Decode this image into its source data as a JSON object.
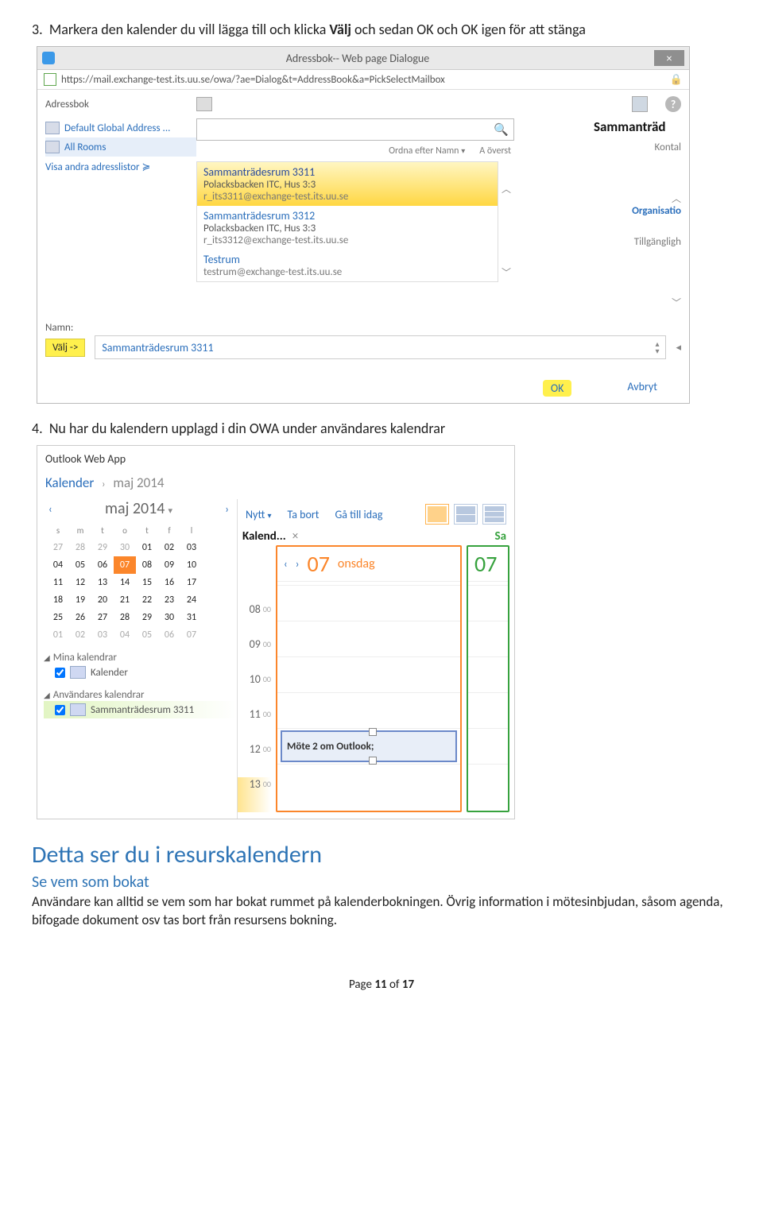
{
  "step3": {
    "num": "3.",
    "pre": "Markera den kalender du vill lägga till och klicka ",
    "b1": "Välj",
    "post": " och sedan OK och OK igen för att stänga"
  },
  "dlg": {
    "title": "Adressbok-- Web page Dialogue",
    "close": "×",
    "url": "https://mail.exchange-test.its.uu.se/owa/?ae=Dialog&t=AddressBook&a=PickSelectMailbox",
    "lock": "🔒",
    "addr_label": "Adressbok",
    "help": "?",
    "left": {
      "default": "Default Global Address ...",
      "all_rooms": "All Rooms",
      "show": "Visa andra adresslistor",
      "expand": "≽"
    },
    "search_mag": "🔍",
    "sort": {
      "ordna": "Ordna efter Namn",
      "arr": "▾",
      "overst": "A överst"
    },
    "list": [
      {
        "t1": "Sammanträdesrum 3311",
        "t2": "Polacksbacken ITC, Hus 3:3",
        "t3": "r_its3311@exchange-test.its.uu.se",
        "sel": true
      },
      {
        "t1": "Sammanträdesrum 3312",
        "t2": "Polacksbacken ITC, Hus 3:3",
        "t3": "r_its3312@exchange-test.its.uu.se",
        "sel": false
      },
      {
        "t1": "Testrum",
        "t2": "",
        "t3": "testrum@exchange-test.its.uu.se",
        "sel": false
      }
    ],
    "scroll": {
      "up": "︿",
      "down": "﹀"
    },
    "right": {
      "hdr": "Sammanträd",
      "kontal": "Kontal",
      "up": "︿",
      "org": "Organisatio",
      "avail": "Tillgängligh",
      "down": "﹀"
    },
    "namn": "Namn:",
    "valj": "Välj ->",
    "chosen": "Sammanträdesrum 3311",
    "stepper_up": "▴",
    "stepper_down": "▾",
    "step_out": "◂",
    "ok": "OK",
    "cancel": "Avbryt"
  },
  "step4": {
    "num": "4.",
    "text": "Nu har du kalendern upplagd i din OWA under användares kalendrar"
  },
  "owa": {
    "brand_pre": "Outlook ",
    "brand_post": "Web App",
    "crumb_cal": "Kalender",
    "crumb_chev": "›",
    "crumb_month": "maj 2014",
    "month_name": "maj 2014",
    "month_dd": "▾",
    "nav_prev": "‹",
    "nav_next": "›",
    "dow": [
      "s",
      "m",
      "t",
      "o",
      "t",
      "f",
      "l"
    ],
    "weeks": [
      [
        "27",
        "28",
        "29",
        "30",
        "01",
        "02",
        "03"
      ],
      [
        "04",
        "05",
        "06",
        "07",
        "08",
        "09",
        "10"
      ],
      [
        "11",
        "12",
        "13",
        "14",
        "15",
        "16",
        "17"
      ],
      [
        "18",
        "19",
        "20",
        "21",
        "22",
        "23",
        "24"
      ],
      [
        "25",
        "26",
        "27",
        "28",
        "29",
        "30",
        "31"
      ],
      [
        "01",
        "02",
        "03",
        "04",
        "05",
        "06",
        "07"
      ]
    ],
    "sel_day": "07",
    "grp_mine": "Mina kalendrar",
    "mine_item": "Kalender",
    "grp_user": "Användares kalendrar",
    "user_item": "Sammanträdesrum 3311",
    "tri": "◢",
    "toolbar": {
      "nytt": "Nytt",
      "dd": "▾",
      "tabort": "Ta bort",
      "idag": "Gå till idag"
    },
    "tab1": "Kalend...",
    "tab1x": "×",
    "tab2": "Sa",
    "day_num": "07",
    "day_name": "onsdag",
    "day2": "07",
    "hours": [
      "08",
      "09",
      "10",
      "11",
      "12",
      "13"
    ],
    "min": "00",
    "meeting": "Möte 2 om Outlook;"
  },
  "h2": "Detta ser du i resurskalendern",
  "h3": "Se vem som bokat",
  "para": "Användare kan alltid se vem som har bokat rummet på kalenderbokningen. Övrig information i mötesinbjudan, såsom agenda, bifogade dokument osv tas bort från resursens bokning.",
  "footer": {
    "pre": "Page ",
    "n": "11",
    "mid": " of ",
    "tot": "17"
  }
}
